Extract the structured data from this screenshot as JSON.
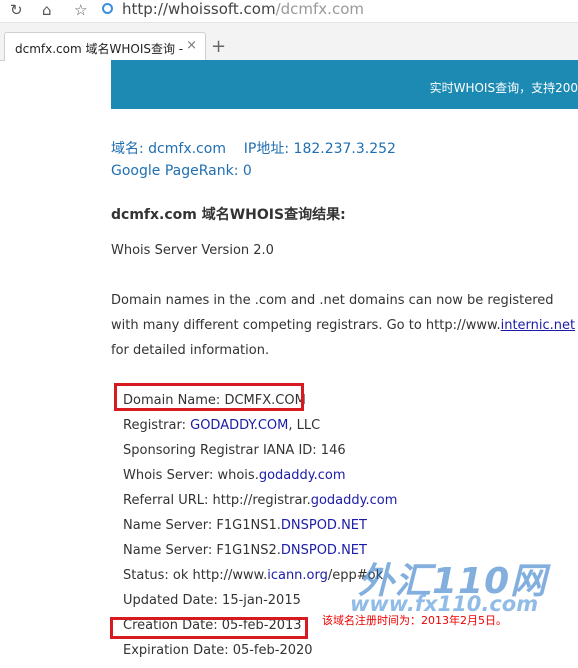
{
  "toolbar": {
    "url_host": "http://whoissoft.com",
    "url_path": "/dcmfx.com"
  },
  "tab": {
    "title": "dcmfx.com 域名WHOIS查询 -",
    "close": "×",
    "new": "+"
  },
  "banner": {
    "text": "实时WHOIS查询，支持200"
  },
  "info": {
    "domain_label": "域名:",
    "domain_value": "dcmfx.com",
    "ip_label": "IP地址:",
    "ip_value": "182.237.3.252",
    "pagerank": "Google PageRank: 0"
  },
  "result": {
    "heading": "dcmfx.com 域名WHOIS查询结果:",
    "server_version": "Whois Server Version 2.0",
    "notice_1": "Domain names in the .com and .net domains can now be registered",
    "notice_2a": "with many different competing registrars. Go to http://www.",
    "notice_2b": "internic.net",
    "notice_3": "for detailed information."
  },
  "whois": {
    "domain_name": "Domain Name: DCMFX.COM",
    "registrar_label": "Registrar: ",
    "registrar_link": "GODADDY.COM",
    "registrar_rest": ", LLC",
    "iana": "Sponsoring Registrar IANA ID: 146",
    "server_label": "Whois Server: whois.",
    "server_link": "godaddy.com",
    "referral_label": "Referral URL: http://registrar.",
    "referral_link": "godaddy.com",
    "ns1_label": "Name Server: F1G1NS1.",
    "ns1_link": "DNSPOD.NET",
    "ns2_label": "Name Server: F1G1NS2.",
    "ns2_link": "DNSPOD.NET",
    "status_label": "Status: ok http://www.",
    "status_link": "icann.org",
    "status_rest": "/epp#ok",
    "updated": "Updated Date: 15-jan-2015",
    "creation": "Creation Date: 05-feb-2013",
    "expiration": "Expiration Date: 05-feb-2020"
  },
  "annotation": "该域名注册时间为：2013年2月5日。",
  "watermark": {
    "line1": "外汇110网",
    "line2": "www.fx110.com"
  },
  "colors": {
    "accent": "#1c8ab3",
    "highlight_box": "#d71920",
    "annotation": "#ee0000"
  }
}
